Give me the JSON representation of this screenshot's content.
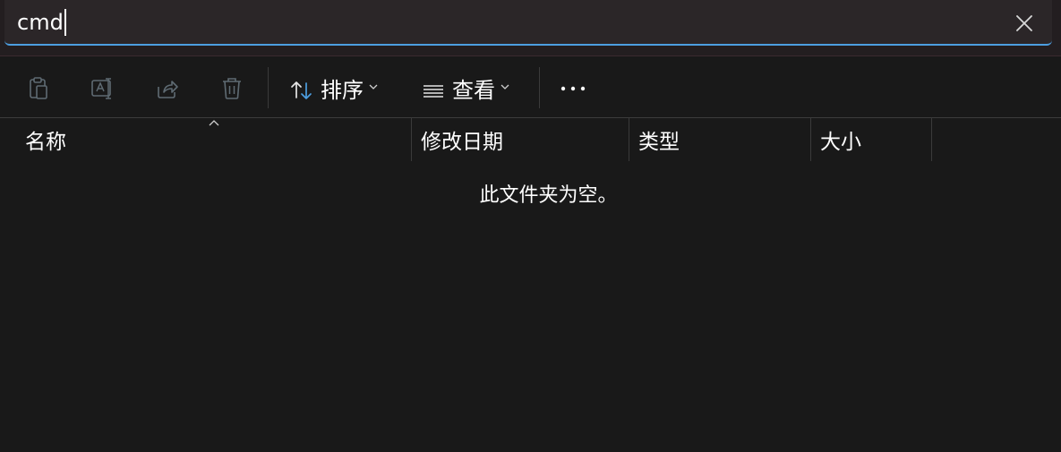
{
  "search": {
    "value": "cmd"
  },
  "toolbar": {
    "icons": [
      "paste-icon",
      "rename-icon",
      "share-icon",
      "delete-icon"
    ],
    "sort_label": "排序",
    "view_label": "查看",
    "more_label": "···"
  },
  "columns": {
    "name": "名称",
    "modified": "修改日期",
    "type": "类型",
    "size": "大小"
  },
  "empty_message": "此文件夹为空。",
  "colors": {
    "background": "#191919",
    "search_bg": "#2b2628",
    "accent": "#4c9ee0",
    "disabled_icon": "#5f6b73"
  }
}
